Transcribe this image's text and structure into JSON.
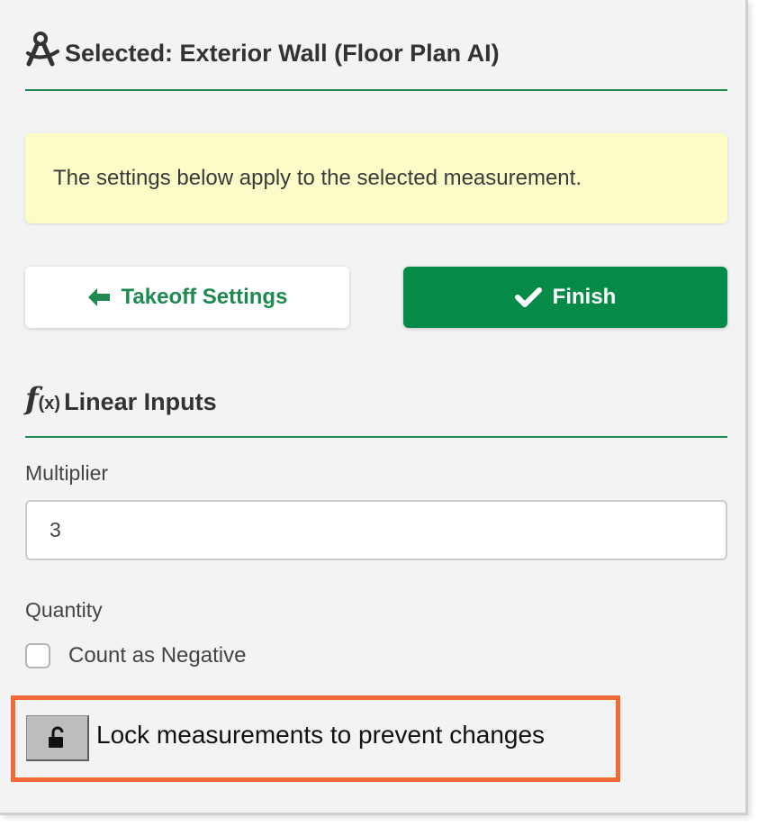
{
  "header": {
    "title": "Selected: Exterior Wall (Floor Plan AI)",
    "icon": "compass-drafting-icon"
  },
  "notice": {
    "text": "The settings below apply to the selected measurement.",
    "background": "#fcfcc9"
  },
  "buttons": {
    "takeoff_settings_label": "Takeoff Settings",
    "takeoff_settings_icon": "arrow-left-icon",
    "finish_label": "Finish",
    "finish_icon": "check-icon"
  },
  "section": {
    "icon_text": "f",
    "icon_sub": "(x)",
    "title": "Linear Inputs"
  },
  "multiplier": {
    "label": "Multiplier",
    "value": "3"
  },
  "quantity": {
    "label": "Quantity",
    "count_negative_label": "Count as Negative",
    "count_negative_checked": false
  },
  "lock": {
    "label": "Lock measurements to prevent changes",
    "icon": "unlocked-padlock-icon"
  },
  "colors": {
    "accent_green": "#068a48",
    "text_green": "#1e8a4f",
    "highlight_orange": "#f26a36"
  }
}
